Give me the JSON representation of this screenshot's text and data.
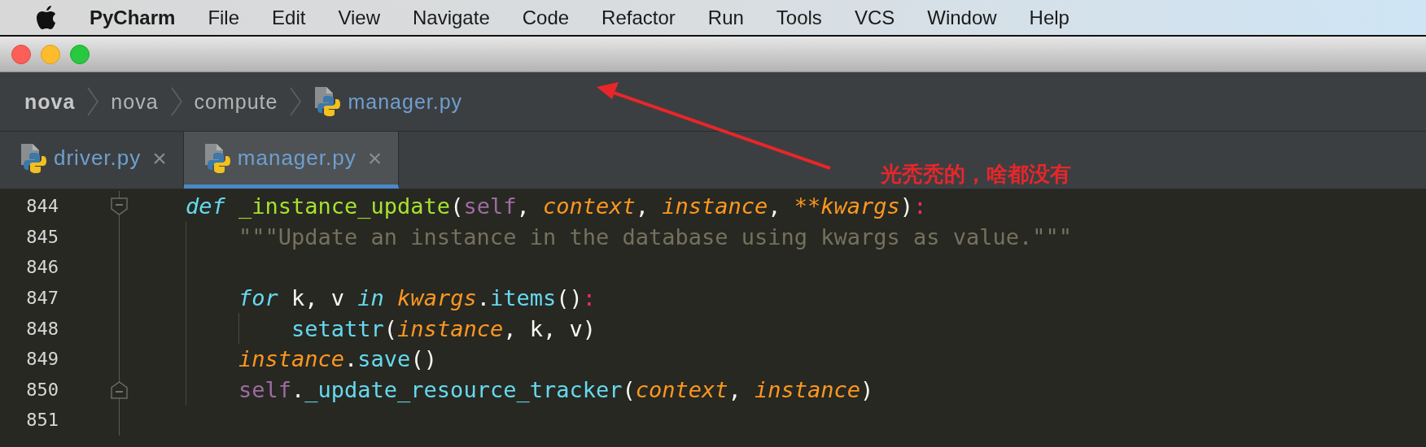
{
  "menu_bar": {
    "app": "PyCharm",
    "items": [
      "File",
      "Edit",
      "View",
      "Navigate",
      "Code",
      "Refactor",
      "Run",
      "Tools",
      "VCS",
      "Window",
      "Help"
    ]
  },
  "breadcrumbs": [
    {
      "label": "nova",
      "kind": "root"
    },
    {
      "label": "nova",
      "kind": "folder"
    },
    {
      "label": "compute",
      "kind": "folder"
    },
    {
      "label": "manager.py",
      "kind": "file"
    }
  ],
  "tabs": [
    {
      "label": "driver.py",
      "close": "×",
      "selected": false
    },
    {
      "label": "manager.py",
      "close": "×",
      "selected": true
    }
  ],
  "editor": {
    "lines": [
      {
        "number": "844",
        "kind": "foldstart",
        "tokens": [
          {
            "t": "def",
            "kind": "keyword"
          },
          {
            "t": " _instance_update",
            "kind": "function"
          },
          {
            "t": "(",
            "kind": "plain"
          },
          {
            "t": "self",
            "kind": "self"
          },
          {
            "t": ", ",
            "kind": "plain"
          },
          {
            "t": "context",
            "kind": "param"
          },
          {
            "t": ", ",
            "kind": "plain"
          },
          {
            "t": "instance",
            "kind": "param"
          },
          {
            "t": ", ",
            "kind": "plain"
          },
          {
            "t": "**kwargs",
            "kind": "param"
          },
          {
            "t": ")",
            "kind": "plain"
          },
          {
            "t": ":",
            "kind": "colon"
          }
        ]
      },
      {
        "number": "845",
        "kind": "plain",
        "tokens": [
          {
            "t": "    \"\"\"Update an instance in the database using kwargs as value.\"\"\"",
            "kind": "doc"
          }
        ]
      },
      {
        "number": "846",
        "kind": "plain"
      },
      {
        "number": "847",
        "kind": "plain",
        "tokens": [
          {
            "t": "    for",
            "kind": "keyword"
          },
          {
            "t": " k, v ",
            "kind": "plain"
          },
          {
            "t": "in",
            "kind": "keyword"
          },
          {
            "t": " kwargs",
            "kind": "param"
          },
          {
            "t": ".",
            "kind": "plain"
          },
          {
            "t": "items",
            "kind": "call"
          },
          {
            "t": "()",
            "kind": "plain"
          },
          {
            "t": ":",
            "kind": "colon"
          }
        ]
      },
      {
        "number": "848",
        "kind": "plain",
        "tokens": [
          {
            "t": "        setattr",
            "kind": "call"
          },
          {
            "t": "(",
            "kind": "plain"
          },
          {
            "t": "instance",
            "kind": "param"
          },
          {
            "t": ", k, v)",
            "kind": "plain"
          }
        ]
      },
      {
        "number": "849",
        "kind": "plain",
        "tokens": [
          {
            "t": "    instance",
            "kind": "param"
          },
          {
            "t": ".",
            "kind": "plain"
          },
          {
            "t": "save",
            "kind": "call"
          },
          {
            "t": "()",
            "kind": "plain"
          }
        ]
      },
      {
        "number": "850",
        "kind": "foldend",
        "tokens": [
          {
            "t": "    self",
            "kind": "self"
          },
          {
            "t": ".",
            "kind": "plain"
          },
          {
            "t": "_update_resource_tracker",
            "kind": "call"
          },
          {
            "t": "(",
            "kind": "plain"
          },
          {
            "t": "context",
            "kind": "param"
          },
          {
            "t": ", ",
            "kind": "plain"
          },
          {
            "t": "instance",
            "kind": "param"
          },
          {
            "t": ")",
            "kind": "plain"
          }
        ]
      },
      {
        "number": "851",
        "kind": "plain"
      }
    ]
  },
  "annotation": {
    "text": "光秃秃的，啥都没有"
  }
}
